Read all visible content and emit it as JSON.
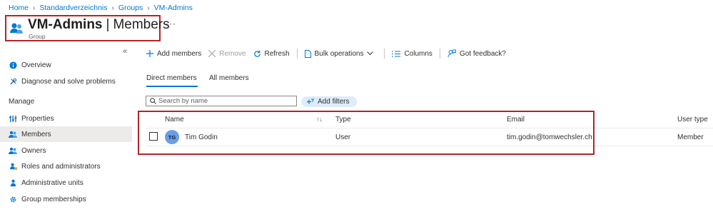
{
  "breadcrumb": [
    "Home",
    "Standardverzeichnis",
    "Groups",
    "VM-Admins"
  ],
  "header": {
    "group_name": "VM-Admins",
    "separator": "|",
    "section": "Members",
    "subtitle": "Group",
    "more": "···"
  },
  "sidebar": {
    "collapse": "«",
    "manage_heading": "Manage",
    "items": [
      {
        "label": "Overview",
        "icon": "info-icon"
      },
      {
        "label": "Diagnose and solve problems",
        "icon": "wrench-icon"
      },
      {
        "label": "Properties",
        "icon": "properties-icon"
      },
      {
        "label": "Members",
        "icon": "members-icon"
      },
      {
        "label": "Owners",
        "icon": "owners-icon"
      },
      {
        "label": "Roles and administrators",
        "icon": "roles-icon"
      },
      {
        "label": "Administrative units",
        "icon": "admin-units-icon"
      },
      {
        "label": "Group memberships",
        "icon": "gear-icon"
      }
    ]
  },
  "toolbar": {
    "add_members": "Add members",
    "remove": "Remove",
    "refresh": "Refresh",
    "bulk_operations": "Bulk operations",
    "columns": "Columns",
    "feedback": "Got feedback?"
  },
  "tabs": {
    "direct": "Direct members",
    "all": "All members"
  },
  "search": {
    "placeholder": "Search by name",
    "value": ""
  },
  "add_filters": "Add filters",
  "table": {
    "columns": {
      "name": "Name",
      "sort_icon": "↑↓",
      "type": "Type",
      "email": "Email",
      "user_type": "User type"
    },
    "rows": [
      {
        "initials": "TG",
        "name": "Tim Godin",
        "type": "User",
        "email": "tim.godin@tomwechsler.ch",
        "user_type": "Member"
      }
    ]
  },
  "colors": {
    "accent": "#0078d4",
    "highlight": "#b3242a",
    "avatar": "#6b9ee8",
    "active_bg": "#edebe9"
  }
}
